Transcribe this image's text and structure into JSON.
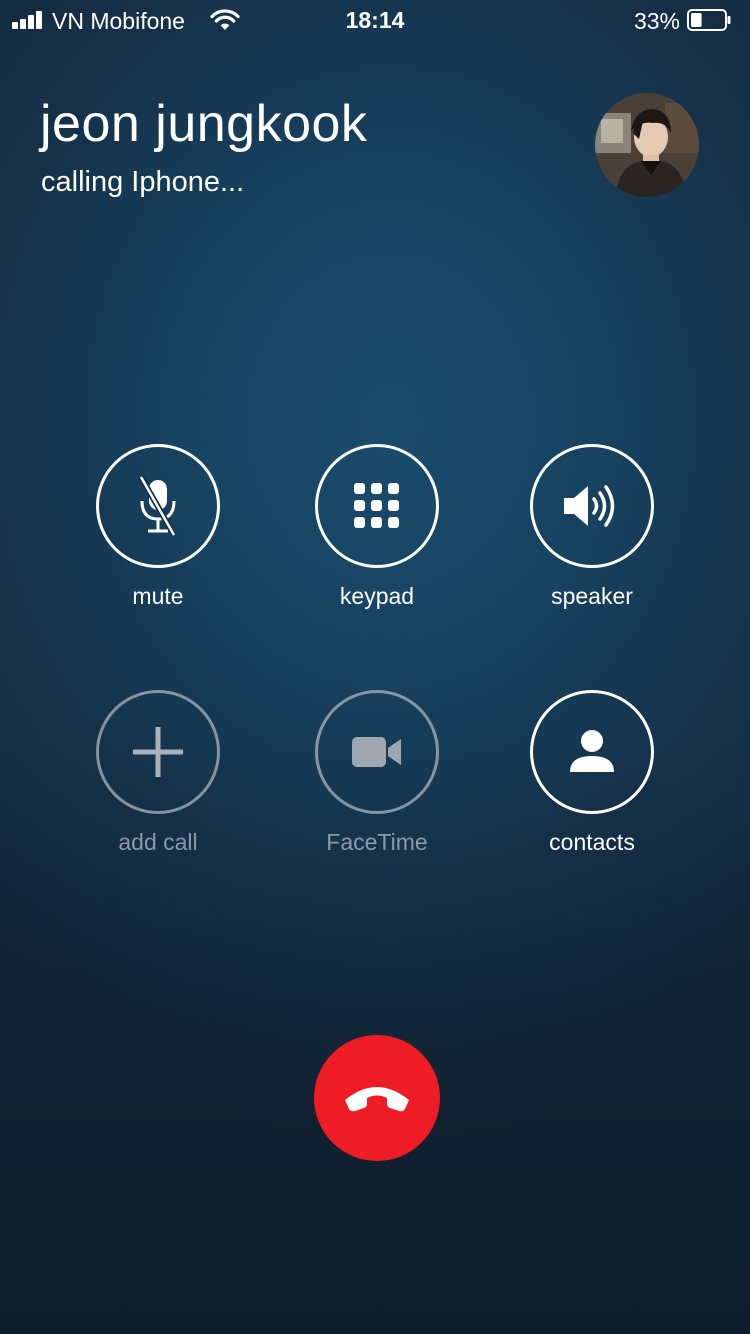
{
  "status_bar": {
    "carrier": "VN Mobifone",
    "time": "18:14",
    "battery_percent": "33%",
    "battery_level": 0.33,
    "signal_bars": 4
  },
  "caller": {
    "name": "jeon jungkook",
    "status": "calling Iphone..."
  },
  "controls": {
    "mute": {
      "label": "mute",
      "icon": "microphone-slash-icon",
      "enabled": true
    },
    "keypad": {
      "label": "keypad",
      "icon": "keypad-grid-icon",
      "enabled": true
    },
    "speaker": {
      "label": "speaker",
      "icon": "speaker-icon",
      "enabled": true
    },
    "add_call": {
      "label": "add call",
      "icon": "plus-icon",
      "enabled": false
    },
    "facetime": {
      "label": "FaceTime",
      "icon": "video-camera-icon",
      "enabled": false
    },
    "contacts": {
      "label": "contacts",
      "icon": "person-icon",
      "enabled": true
    }
  },
  "end_call": {
    "icon": "hang-up-icon",
    "color": "#ee1c25"
  }
}
